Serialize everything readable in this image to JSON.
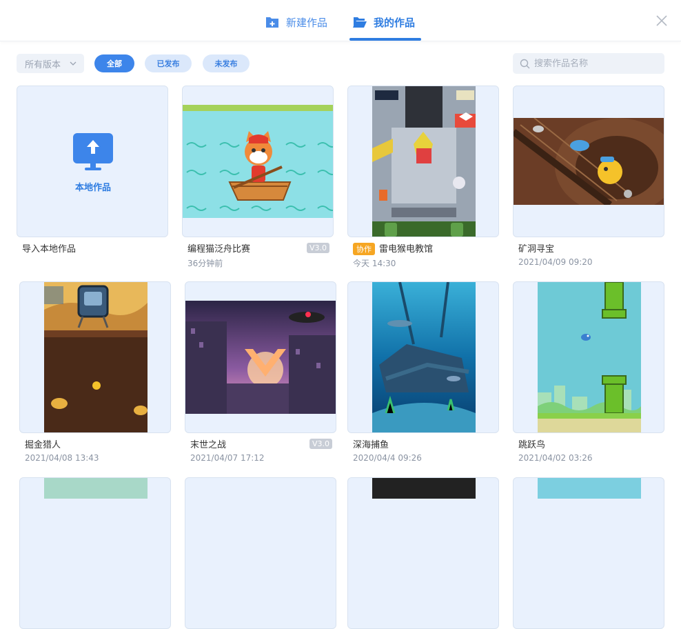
{
  "header": {
    "tabs": [
      {
        "label": "新建作品",
        "icon": "folder-plus-icon"
      },
      {
        "label": "我的作品",
        "icon": "folder-open-icon",
        "active": true
      }
    ],
    "close_icon": "close-icon"
  },
  "filters": {
    "version_select": "所有版本",
    "pills": [
      "全部",
      "已发布",
      "未发布"
    ],
    "active_pill": "全部",
    "search_placeholder": "搜索作品名称"
  },
  "colors": {
    "accent": "#3d85ea",
    "collab": "#f6a623",
    "card_bg": "#e9f1fd"
  },
  "import_card": {
    "label": "本地作品",
    "caption": "导入本地作品",
    "icon": "upload-icon"
  },
  "projects": [
    {
      "title": "编程猫泛舟比赛",
      "time": "36分钟前",
      "version": "V3.0"
    },
    {
      "title": "雷电猴电教馆",
      "time": "今天  14:30",
      "tag": "协作"
    },
    {
      "title": "矿洞寻宝",
      "time": "2021/04/09  09:20"
    },
    {
      "title": "掘金猎人",
      "time": "2021/04/08  13:43"
    },
    {
      "title": "末世之战",
      "time": "2021/04/07  17:12",
      "version": "V3.0"
    },
    {
      "title": "深海捕鱼",
      "time": "2020/04/4  09:26"
    },
    {
      "title": "跳跃鸟",
      "time": "2021/04/02  03:26"
    }
  ]
}
